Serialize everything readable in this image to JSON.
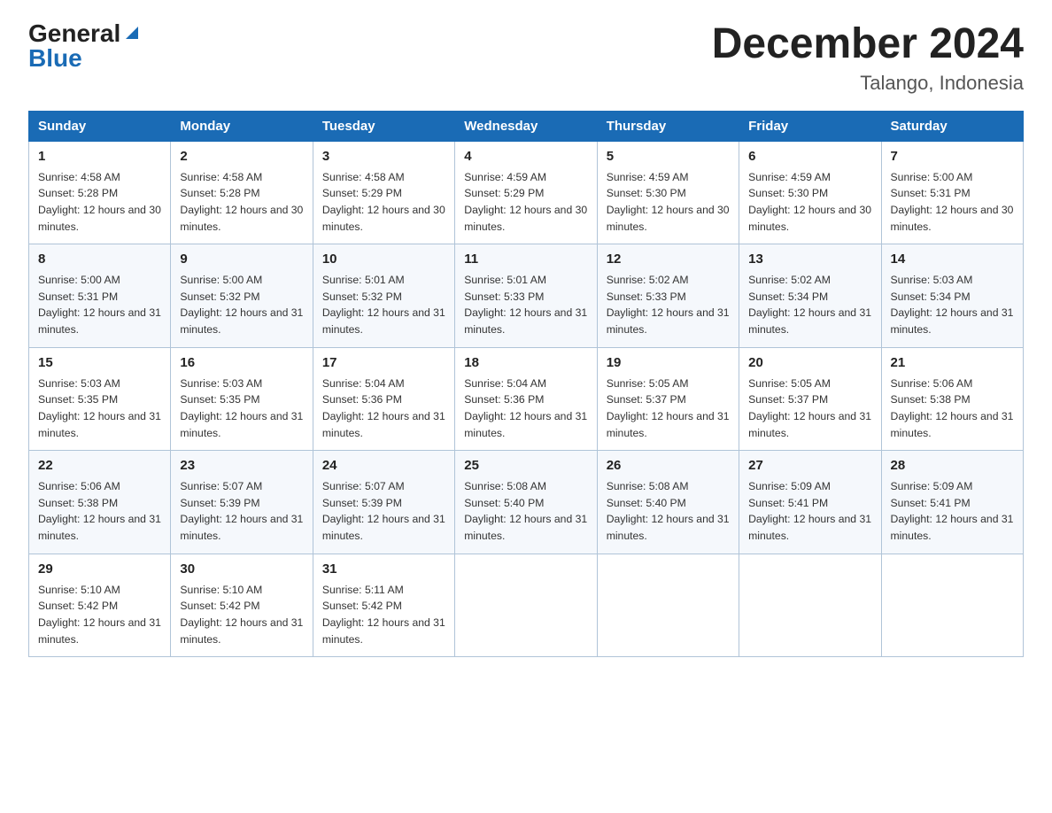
{
  "header": {
    "logo_general": "General",
    "logo_blue": "Blue",
    "month_title": "December 2024",
    "location": "Talango, Indonesia"
  },
  "days_of_week": [
    "Sunday",
    "Monday",
    "Tuesday",
    "Wednesday",
    "Thursday",
    "Friday",
    "Saturday"
  ],
  "weeks": [
    [
      {
        "day": "1",
        "sunrise": "4:58 AM",
        "sunset": "5:28 PM",
        "daylight": "12 hours and 30 minutes."
      },
      {
        "day": "2",
        "sunrise": "4:58 AM",
        "sunset": "5:28 PM",
        "daylight": "12 hours and 30 minutes."
      },
      {
        "day": "3",
        "sunrise": "4:58 AM",
        "sunset": "5:29 PM",
        "daylight": "12 hours and 30 minutes."
      },
      {
        "day": "4",
        "sunrise": "4:59 AM",
        "sunset": "5:29 PM",
        "daylight": "12 hours and 30 minutes."
      },
      {
        "day": "5",
        "sunrise": "4:59 AM",
        "sunset": "5:30 PM",
        "daylight": "12 hours and 30 minutes."
      },
      {
        "day": "6",
        "sunrise": "4:59 AM",
        "sunset": "5:30 PM",
        "daylight": "12 hours and 30 minutes."
      },
      {
        "day": "7",
        "sunrise": "5:00 AM",
        "sunset": "5:31 PM",
        "daylight": "12 hours and 30 minutes."
      }
    ],
    [
      {
        "day": "8",
        "sunrise": "5:00 AM",
        "sunset": "5:31 PM",
        "daylight": "12 hours and 31 minutes."
      },
      {
        "day": "9",
        "sunrise": "5:00 AM",
        "sunset": "5:32 PM",
        "daylight": "12 hours and 31 minutes."
      },
      {
        "day": "10",
        "sunrise": "5:01 AM",
        "sunset": "5:32 PM",
        "daylight": "12 hours and 31 minutes."
      },
      {
        "day": "11",
        "sunrise": "5:01 AM",
        "sunset": "5:33 PM",
        "daylight": "12 hours and 31 minutes."
      },
      {
        "day": "12",
        "sunrise": "5:02 AM",
        "sunset": "5:33 PM",
        "daylight": "12 hours and 31 minutes."
      },
      {
        "day": "13",
        "sunrise": "5:02 AM",
        "sunset": "5:34 PM",
        "daylight": "12 hours and 31 minutes."
      },
      {
        "day": "14",
        "sunrise": "5:03 AM",
        "sunset": "5:34 PM",
        "daylight": "12 hours and 31 minutes."
      }
    ],
    [
      {
        "day": "15",
        "sunrise": "5:03 AM",
        "sunset": "5:35 PM",
        "daylight": "12 hours and 31 minutes."
      },
      {
        "day": "16",
        "sunrise": "5:03 AM",
        "sunset": "5:35 PM",
        "daylight": "12 hours and 31 minutes."
      },
      {
        "day": "17",
        "sunrise": "5:04 AM",
        "sunset": "5:36 PM",
        "daylight": "12 hours and 31 minutes."
      },
      {
        "day": "18",
        "sunrise": "5:04 AM",
        "sunset": "5:36 PM",
        "daylight": "12 hours and 31 minutes."
      },
      {
        "day": "19",
        "sunrise": "5:05 AM",
        "sunset": "5:37 PM",
        "daylight": "12 hours and 31 minutes."
      },
      {
        "day": "20",
        "sunrise": "5:05 AM",
        "sunset": "5:37 PM",
        "daylight": "12 hours and 31 minutes."
      },
      {
        "day": "21",
        "sunrise": "5:06 AM",
        "sunset": "5:38 PM",
        "daylight": "12 hours and 31 minutes."
      }
    ],
    [
      {
        "day": "22",
        "sunrise": "5:06 AM",
        "sunset": "5:38 PM",
        "daylight": "12 hours and 31 minutes."
      },
      {
        "day": "23",
        "sunrise": "5:07 AM",
        "sunset": "5:39 PM",
        "daylight": "12 hours and 31 minutes."
      },
      {
        "day": "24",
        "sunrise": "5:07 AM",
        "sunset": "5:39 PM",
        "daylight": "12 hours and 31 minutes."
      },
      {
        "day": "25",
        "sunrise": "5:08 AM",
        "sunset": "5:40 PM",
        "daylight": "12 hours and 31 minutes."
      },
      {
        "day": "26",
        "sunrise": "5:08 AM",
        "sunset": "5:40 PM",
        "daylight": "12 hours and 31 minutes."
      },
      {
        "day": "27",
        "sunrise": "5:09 AM",
        "sunset": "5:41 PM",
        "daylight": "12 hours and 31 minutes."
      },
      {
        "day": "28",
        "sunrise": "5:09 AM",
        "sunset": "5:41 PM",
        "daylight": "12 hours and 31 minutes."
      }
    ],
    [
      {
        "day": "29",
        "sunrise": "5:10 AM",
        "sunset": "5:42 PM",
        "daylight": "12 hours and 31 minutes."
      },
      {
        "day": "30",
        "sunrise": "5:10 AM",
        "sunset": "5:42 PM",
        "daylight": "12 hours and 31 minutes."
      },
      {
        "day": "31",
        "sunrise": "5:11 AM",
        "sunset": "5:42 PM",
        "daylight": "12 hours and 31 minutes."
      },
      null,
      null,
      null,
      null
    ]
  ]
}
